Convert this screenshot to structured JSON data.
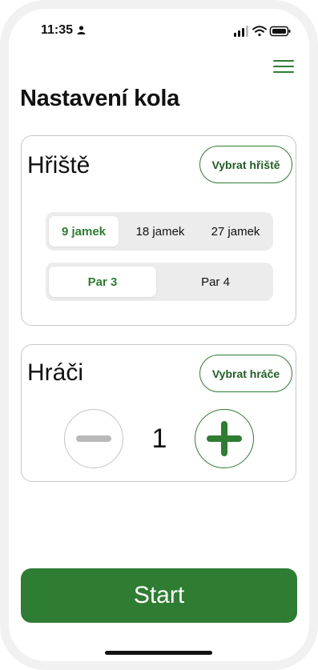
{
  "status": {
    "time": "11:35"
  },
  "page": {
    "title": "Nastavení kola"
  },
  "course": {
    "title": "Hřiště",
    "select_label": "Vybrat hřiště",
    "holes": [
      {
        "label": "9 jamek",
        "selected": true
      },
      {
        "label": "18 jamek",
        "selected": false
      },
      {
        "label": "27 jamek",
        "selected": false
      }
    ],
    "par": [
      {
        "label": "Par 3",
        "selected": true
      },
      {
        "label": "Par 4",
        "selected": false
      }
    ]
  },
  "players": {
    "title": "Hráči",
    "select_label": "Vybrat hráče",
    "count": "1"
  },
  "start_label": "Start",
  "colors": {
    "accent": "#2e7d32",
    "segment_bg": "#ececec",
    "disabled": "#b9b9b9"
  },
  "icons": [
    "person-icon",
    "cellular-signal-icon",
    "wifi-icon",
    "battery-icon",
    "hamburger-menu-icon",
    "minus-icon",
    "plus-icon"
  ]
}
